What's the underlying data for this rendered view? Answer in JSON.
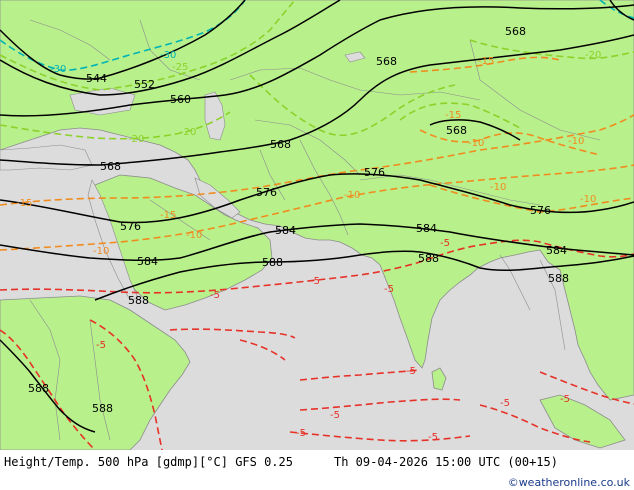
{
  "map": {
    "colors": {
      "land": "#b8f08c",
      "sea": "#dcdcdc",
      "height_contour": "#000000",
      "temp_cold": "#00b4b4",
      "temp_cool": "#8cd22a",
      "temp_mild": "#f08c1e",
      "temp_warm": "#e63228",
      "border": "#8c8c8c"
    },
    "height_labels": [
      "544",
      "552",
      "560",
      "568",
      "576",
      "584",
      "588"
    ],
    "temp_labels": [
      "-30",
      "-25",
      "-20",
      "-15",
      "-10",
      "-5"
    ]
  },
  "footer": {
    "title": "Height/Temp. 500 hPa [gdmp][°C] GFS 0.25",
    "datetime": "Th 09-04-2026 15:00 UTC (00+15)",
    "credit": "©weatheronline.co.uk"
  }
}
